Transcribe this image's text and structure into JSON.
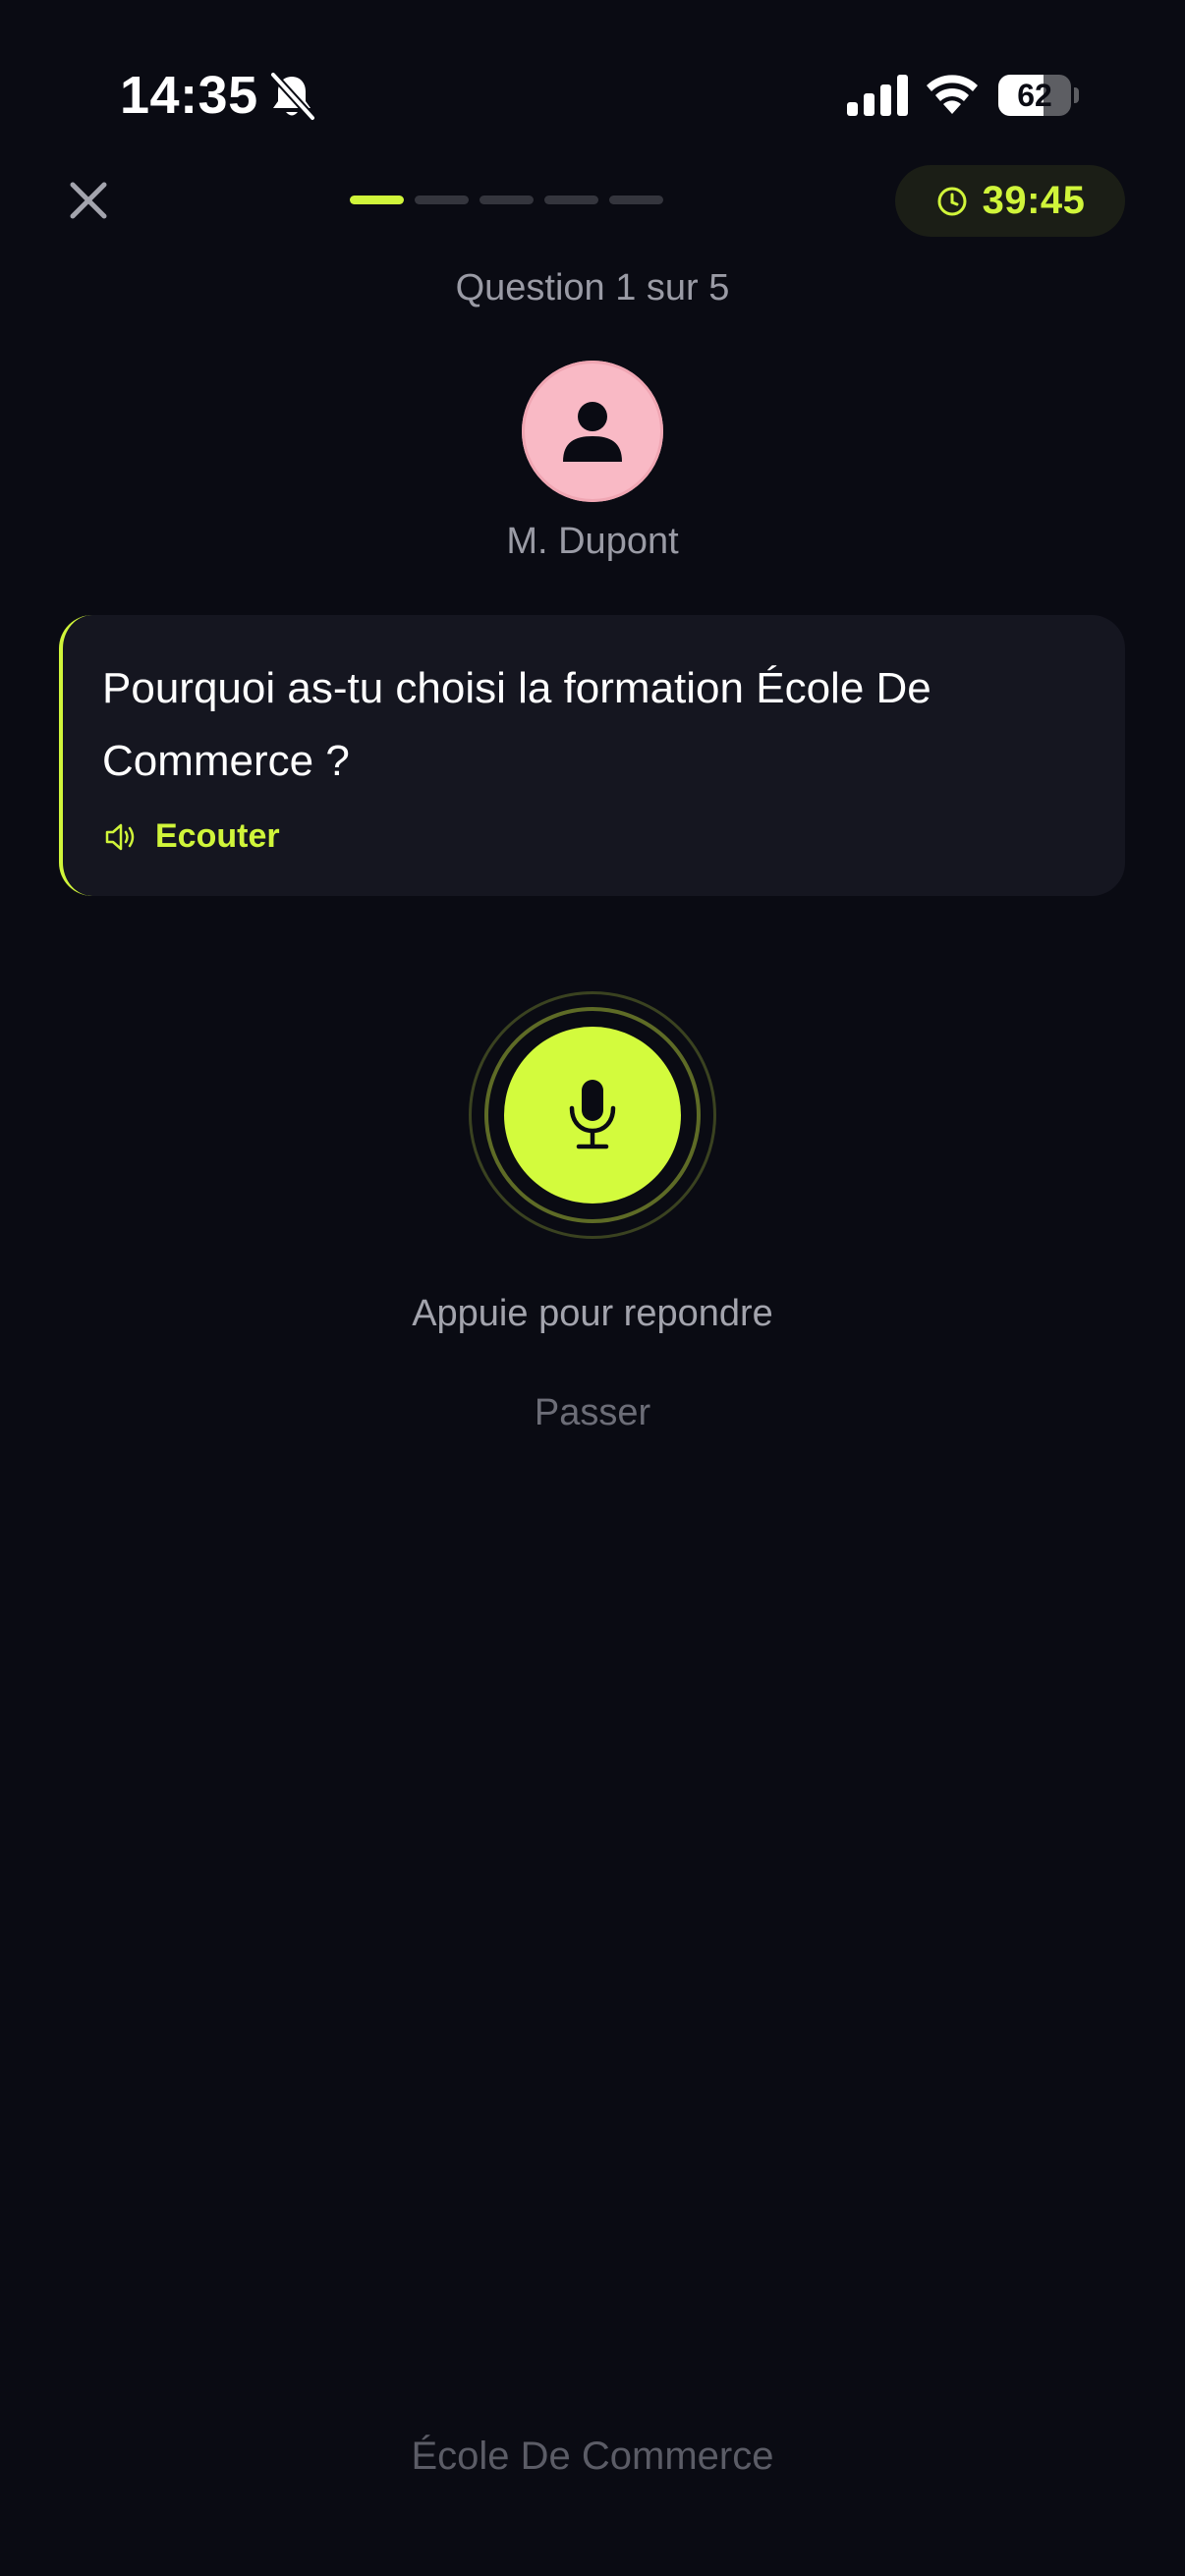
{
  "status_bar": {
    "time": "14:35",
    "battery_percent": "62",
    "battery_level": 0.62,
    "icons": [
      "bell-off-icon",
      "signal-icon",
      "wifi-icon",
      "battery-icon"
    ]
  },
  "header": {
    "close_icon": "close-icon",
    "progress": {
      "current": 1,
      "total": 5
    },
    "timer": "39:45",
    "timer_icon": "clock-icon"
  },
  "question_counter": "Question 1 sur 5",
  "interviewer": {
    "name": "M. Dupont",
    "avatar_icon": "person-icon"
  },
  "question": {
    "text": "Pourquoi as-tu choisi la formation École De Commerce ?",
    "listen_label": "Ecouter",
    "listen_icon": "speaker-icon"
  },
  "recorder": {
    "mic_icon": "microphone-icon",
    "hint": "Appuie pour repondre",
    "skip_label": "Passer"
  },
  "footer": {
    "label": "École De Commerce"
  },
  "colors": {
    "background": "#0a0b13",
    "accent": "#d0f53a",
    "card": "#151620",
    "muted_text": "#9a9ba5",
    "avatar_bg": "#f9b9c5"
  }
}
